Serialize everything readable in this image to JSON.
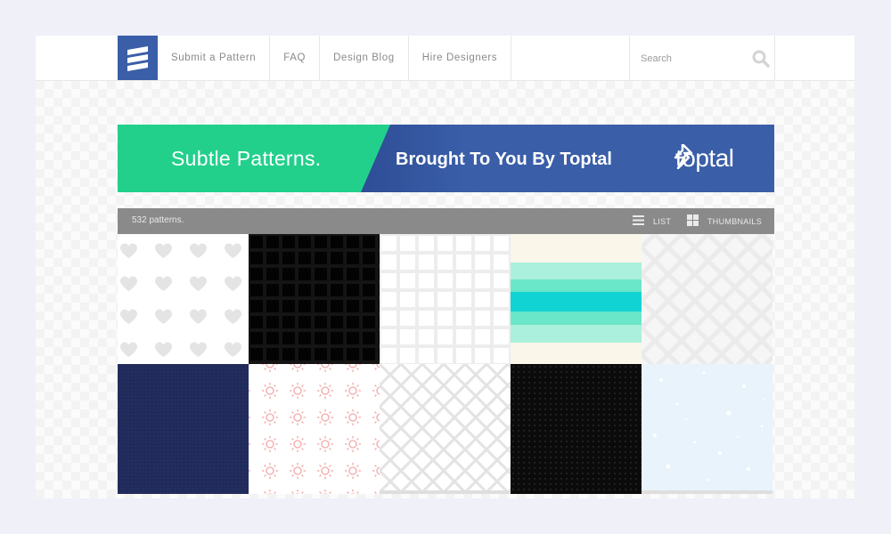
{
  "nav": {
    "items": [
      "Submit a Pattern",
      "FAQ",
      "Design Blog",
      "Hire Designers"
    ]
  },
  "search": {
    "placeholder": "Search"
  },
  "banner": {
    "title": "Subtle Patterns.",
    "subtitle": "Brought To You By Toptal",
    "brand": "toptal"
  },
  "toolbar": {
    "count": "532 patterns.",
    "list_label": "LIST",
    "thumbnails_label": "THUMBNAILS"
  },
  "colors": {
    "brand_blue": "#3b5ea8",
    "banner_green": "#22d08c",
    "toolbar_gray": "#8a8a8a"
  },
  "patterns": [
    "hearts",
    "dark-grid",
    "white-grid",
    "mint-stripes",
    "zigzag",
    "navy-texture",
    "pink-suns",
    "diamond-lattice",
    "black-dots",
    "light-blue-speckle"
  ]
}
